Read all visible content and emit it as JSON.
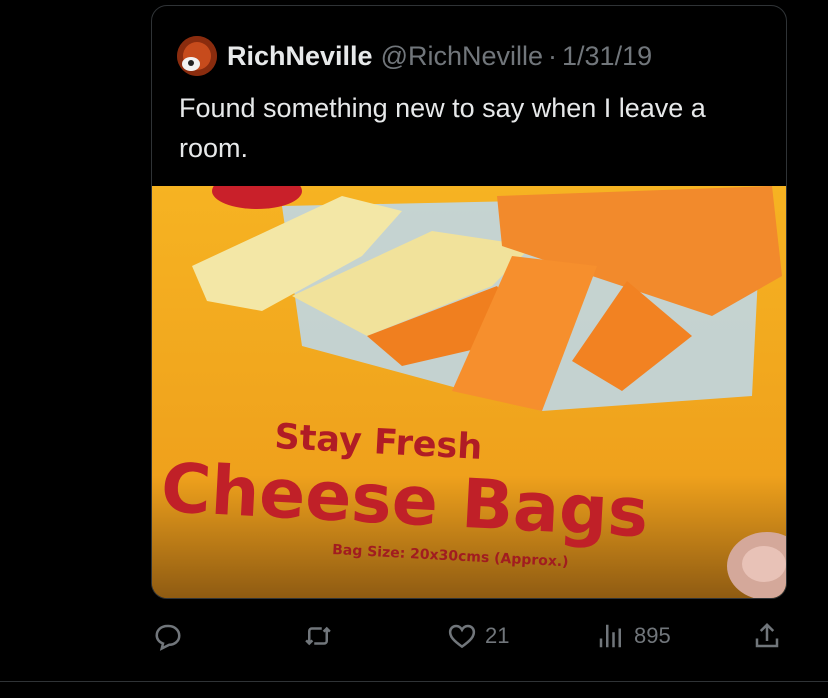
{
  "tweet": {
    "author_name": "RichNeville",
    "author_handle": "@RichNeville",
    "separator": "·",
    "date": "1/31/19",
    "text": "Found something new to say when I leave a room.",
    "image": {
      "text_line1": "Stay Fresh",
      "text_line2": "Cheese Bags",
      "text_line3": "Bag Size: 20x30cms (Approx.)"
    }
  },
  "actions": {
    "reply_icon": "reply-icon",
    "retweet_icon": "retweet-icon",
    "like_icon": "heart-icon",
    "like_count": "21",
    "views_icon": "views-icon",
    "views_count": "895",
    "share_icon": "share-icon"
  },
  "colors": {
    "background": "#000000",
    "text_primary": "#e7e9ea",
    "text_secondary": "#71767b",
    "border": "#2f3336"
  }
}
